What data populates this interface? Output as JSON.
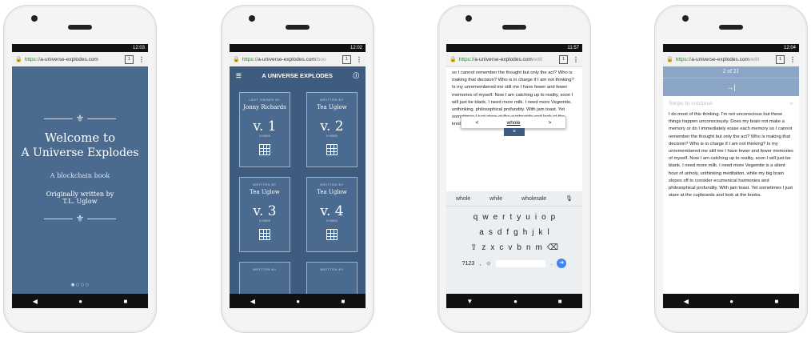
{
  "common": {
    "url_prefix": "https://",
    "url_domain": "a-universe-explodes.com",
    "tabs": "1",
    "menu": "⋮",
    "back": "◀",
    "home": "●",
    "recent": "■"
  },
  "phone1": {
    "time": "12:03",
    "title_line1": "Welcome to",
    "title_line2": "A Universe Explodes",
    "subtitle": "A blockchain book",
    "credit_line1": "Originally written by",
    "credit_line2": "T.L. Uglow",
    "dots": "● ○ ○ ○"
  },
  "phone2": {
    "time": "12:02",
    "url_suffix": "/boo",
    "header": "A UNIVERSE EXPLODES",
    "cards": [
      {
        "label": "LAST OWNED BY",
        "name": "Jonny Richards",
        "vol": "v. 1",
        "owns": "2 OWNS"
      },
      {
        "label": "WRITTEN BY",
        "name": "Tea Uglow",
        "vol": "v. 2",
        "owns": "0 OWNS"
      },
      {
        "label": "WRITTEN BY",
        "name": "Tea Uglow",
        "vol": "v. 3",
        "owns": "0 OWNS"
      },
      {
        "label": "WRITTEN BY",
        "name": "Tea Uglow",
        "vol": "v. 4",
        "owns": "0 OWNS"
      },
      {
        "label": "WRITTEN BY",
        "name": "",
        "vol": "",
        "owns": ""
      },
      {
        "label": "WRITTEN BY",
        "name": "",
        "vol": "",
        "owns": ""
      }
    ]
  },
  "phone3": {
    "time": "11:57",
    "url_suffix": "/edit",
    "text": "so I cannot remember the thought but only the act? Who is making that decision? Who is in charge if I am not thinking? Is my unremembered me still me I have fewer and fewer memories of myself. Now I am catching up to reality, soon I will just be blank. I need more milk. I need more Vegemite, unthinking, philosophical profundity. With jam toast. Yet sometimes I just stare at the cupboards and look at the knobs.",
    "popup_word": "whole",
    "popup_left": "<",
    "popup_right": ">",
    "popup_close": "×",
    "suggestions": [
      "whole",
      "while",
      "wholesale"
    ],
    "row1": [
      "q",
      "w",
      "e",
      "r",
      "t",
      "y",
      "u",
      "i",
      "o",
      "p"
    ],
    "row2": [
      "a",
      "s",
      "d",
      "f",
      "g",
      "h",
      "j",
      "k",
      "l"
    ],
    "row3": [
      "⇧",
      "z",
      "x",
      "c",
      "v",
      "b",
      "n",
      "m",
      "⌫"
    ],
    "row4_left": "?123",
    "row4_comma": ",",
    "row4_period": ".",
    "enter": "➜"
  },
  "phone4": {
    "time": "12:04",
    "url_suffix": "/edit",
    "page": "2 of 21",
    "arrow": "→|",
    "swipe": "Swipe to continue",
    "text": "I do most of this thinking. I'm not unconscious but these things happen unconsciously. Does my brain not make a memory or do I immediately erase each memory so I cannot remember the thought but only the act? Who is making that decision? Who is in charge if I am not thinking? Is my unremembered me still me I have fewer and fewer memories of myself. Now I am catching up to reality, soon I will just be blank. I need more milk. I need more Vegemite is a silent hour of unholy, unthinking meditation, while my big brain slopes off to consider ecumenical harmonies and philosophical profundity. With jam toast. Yet sometimes I just stare at the cupboards and look at the knobs."
  }
}
